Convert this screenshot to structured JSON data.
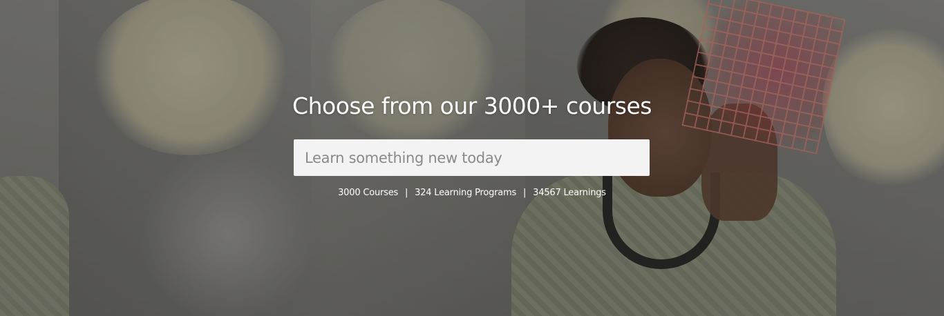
{
  "hero": {
    "headline": "Choose from our 3000+ courses",
    "search": {
      "placeholder": "Learn something new today",
      "value": ""
    },
    "stats": {
      "courses": "3000 Courses",
      "separator_1": "|",
      "programs": "324 Learning Programs",
      "separator_2": "|",
      "learnings": "34567 Learnings"
    }
  },
  "colors": {
    "headline_text": "#ffffff",
    "search_background": "#f3f3f3",
    "placeholder_text": "#8a8a8a"
  },
  "background_image": "photo-of-student-holding-3d-printed-lattice-cube"
}
